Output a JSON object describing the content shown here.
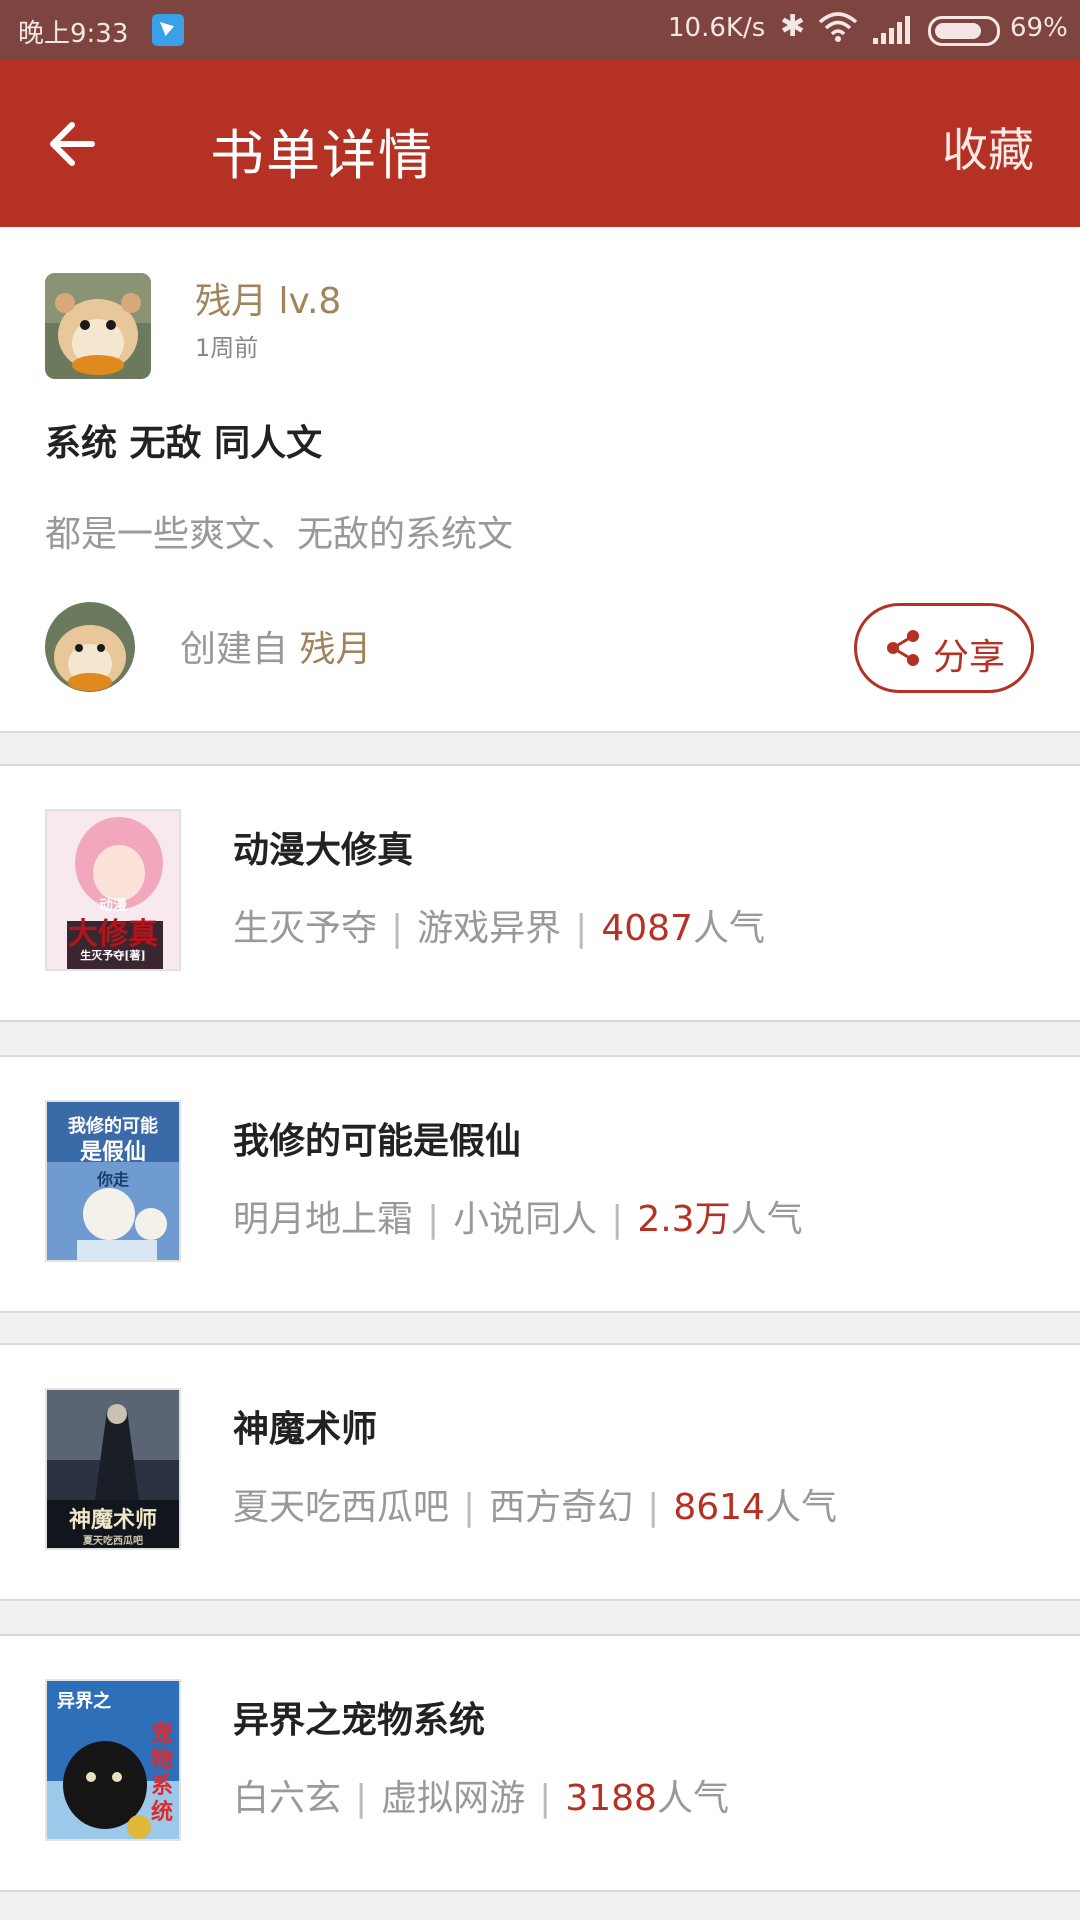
{
  "status_bar": {
    "time": "晚上9:33",
    "net_speed": "10.6K/s",
    "battery": "69%"
  },
  "header": {
    "title": "书单详情",
    "favorite_label": "收藏"
  },
  "booklist": {
    "user_name": "残月 lv.8",
    "posted": "1周前",
    "tags": "系统 无敌 同人文",
    "description": "都是一些爽文、无敌的系统文",
    "created_by_prefix": "创建自",
    "creator": "残月",
    "share_label": "分享"
  },
  "books": [
    {
      "title": "动漫大修真",
      "author": "生灭予夺",
      "category": "游戏异界",
      "popularity_num": "4087",
      "popularity_unit": "人气"
    },
    {
      "title": "我修的可能是假仙",
      "author": "明月地上霜",
      "category": "小说同人",
      "popularity_num": "2.3万",
      "popularity_unit": "人气"
    },
    {
      "title": "神魔术师",
      "author": "夏天吃西瓜吧",
      "category": "西方奇幻",
      "popularity_num": "8614",
      "popularity_unit": "人气"
    },
    {
      "title": "异界之宠物系统",
      "author": "白六玄",
      "category": "虚拟网游",
      "popularity_num": "3188",
      "popularity_unit": "人气"
    }
  ],
  "covers": {
    "book1": {
      "big": "大修真",
      "small": "动漫",
      "author": "生灭予夺[著]"
    },
    "book2": {
      "line1": "我修的可能",
      "line2": "是假仙",
      "note": "你走"
    },
    "book3": {
      "big": "神魔术师",
      "author": "夏天吃西瓜吧"
    },
    "book4": {
      "v1": "异界之",
      "v2": "宠物系统"
    }
  },
  "colors": {
    "primary": "#b53123",
    "status_bar": "#7e4540",
    "username": "#a0855c",
    "muted": "#999999"
  }
}
